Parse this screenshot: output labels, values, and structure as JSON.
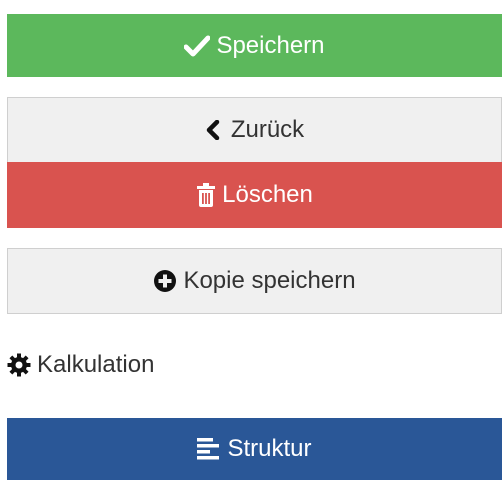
{
  "buttons": {
    "save_label": "Speichern",
    "back_label": "Zurück",
    "delete_label": "Löschen",
    "copy_label": "Kopie speichern",
    "structure_label": "Struktur"
  },
  "links": {
    "calculation_label": "Kalkulation"
  },
  "icons": {
    "save": "check-icon",
    "back": "chevron-left-icon",
    "delete": "trash-icon",
    "copy": "plus-circle-icon",
    "calculation": "gear-icon",
    "structure": "align-left-icon"
  },
  "colors": {
    "save": "#5cb85c",
    "delete": "#d9534f",
    "structure": "#2a5797",
    "default": "#f0f0f0"
  }
}
